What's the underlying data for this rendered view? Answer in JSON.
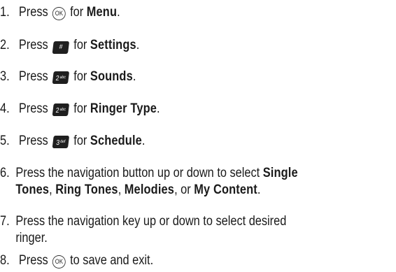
{
  "steps": [
    {
      "num": "1.",
      "pre": "Press",
      "key": "OK",
      "mid": "for",
      "bold": "Menu",
      "post": "."
    },
    {
      "num": "2.",
      "pre": "Press",
      "key": "#",
      "mid": "for",
      "bold": "Settings",
      "post": "."
    },
    {
      "num": "3.",
      "pre": "Press",
      "key": "2",
      "key_sub": "abc",
      "mid": "for",
      "bold": "Sounds",
      "post": "."
    },
    {
      "num": "4.",
      "pre": "Press",
      "key": "2",
      "key_sub": "abc",
      "mid": "for",
      "bold": "Ringer Type",
      "post": "."
    },
    {
      "num": "5.",
      "pre": "Press",
      "key": "3",
      "key_sub": "def",
      "mid": "for",
      "bold": "Schedule",
      "post": "."
    },
    {
      "num": "6.",
      "line1": "Press the navigation button up or down to select",
      "b1": "Single",
      "b2": "Tones",
      "sep1": ",",
      "b3": "Ring Tones",
      "sep2": ",",
      "b4": "Melodies",
      "sep3": ", or",
      "b5": "My Content",
      "post": "."
    },
    {
      "num": "7.",
      "line1": "Press the navigation key up or down to select desired",
      "line2": "ringer."
    },
    {
      "num": "8.",
      "pre": "Press",
      "key": "OK",
      "post": "to save and exit."
    }
  ]
}
